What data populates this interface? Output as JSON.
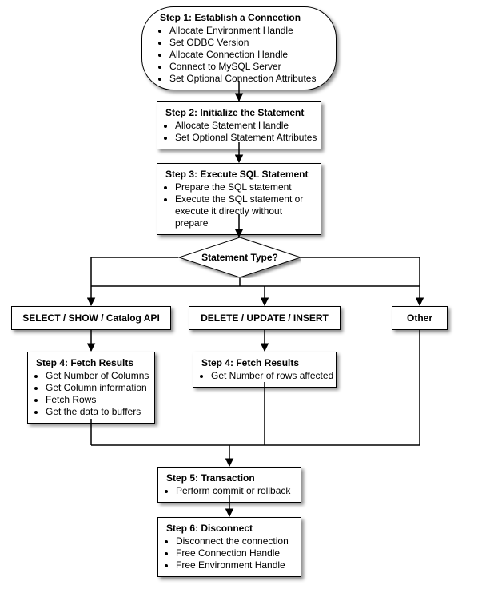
{
  "chart_data": {
    "type": "flowchart",
    "nodes": [
      {
        "id": "step1",
        "shape": "rounded",
        "title": "Step 1: Establish a Connection",
        "bullets": [
          "Allocate Environment Handle",
          "Set ODBC Version",
          "Allocate Connection Handle",
          "Connect to MySQL Server",
          "Set Optional Connection Attributes"
        ]
      },
      {
        "id": "step2",
        "shape": "rect",
        "title": "Step 2: Initialize the Statement",
        "bullets": [
          "Allocate Statement Handle",
          "Set Optional Statement Attributes"
        ]
      },
      {
        "id": "step3",
        "shape": "rect",
        "title": "Step 3: Execute SQL Statement",
        "bullets": [
          "Prepare the SQL statement",
          "Execute the SQL statement or execute it directly without prepare"
        ]
      },
      {
        "id": "decision",
        "shape": "diamond",
        "title": "Statement Type?"
      },
      {
        "id": "branch_select",
        "shape": "rect",
        "title": "SELECT / SHOW / Catalog API"
      },
      {
        "id": "branch_dml",
        "shape": "rect",
        "title": "DELETE / UPDATE / INSERT"
      },
      {
        "id": "branch_other",
        "shape": "rect",
        "title": "Other"
      },
      {
        "id": "step4a",
        "shape": "rect",
        "title": "Step 4: Fetch Results",
        "bullets": [
          "Get Number of Columns",
          "Get Column information",
          "Fetch Rows",
          "Get the data to buffers"
        ]
      },
      {
        "id": "step4b",
        "shape": "rect",
        "title": "Step 4: Fetch Results",
        "bullets": [
          "Get Number of rows affected"
        ]
      },
      {
        "id": "step5",
        "shape": "rect",
        "title": "Step 5: Transaction",
        "bullets": [
          "Perform commit or rollback"
        ]
      },
      {
        "id": "step6",
        "shape": "rect",
        "title": "Step 6: Disconnect",
        "bullets": [
          "Disconnect the connection",
          "Free Connection Handle",
          "Free Environment Handle"
        ]
      }
    ],
    "edges": [
      [
        "step1",
        "step2"
      ],
      [
        "step2",
        "step3"
      ],
      [
        "step3",
        "decision"
      ],
      [
        "decision",
        "branch_select"
      ],
      [
        "decision",
        "branch_dml"
      ],
      [
        "decision",
        "branch_other"
      ],
      [
        "branch_select",
        "step4a"
      ],
      [
        "branch_dml",
        "step4b"
      ],
      [
        "step4a",
        "step5"
      ],
      [
        "step4b",
        "step5"
      ],
      [
        "branch_other",
        "step5"
      ],
      [
        "step5",
        "step6"
      ]
    ]
  }
}
